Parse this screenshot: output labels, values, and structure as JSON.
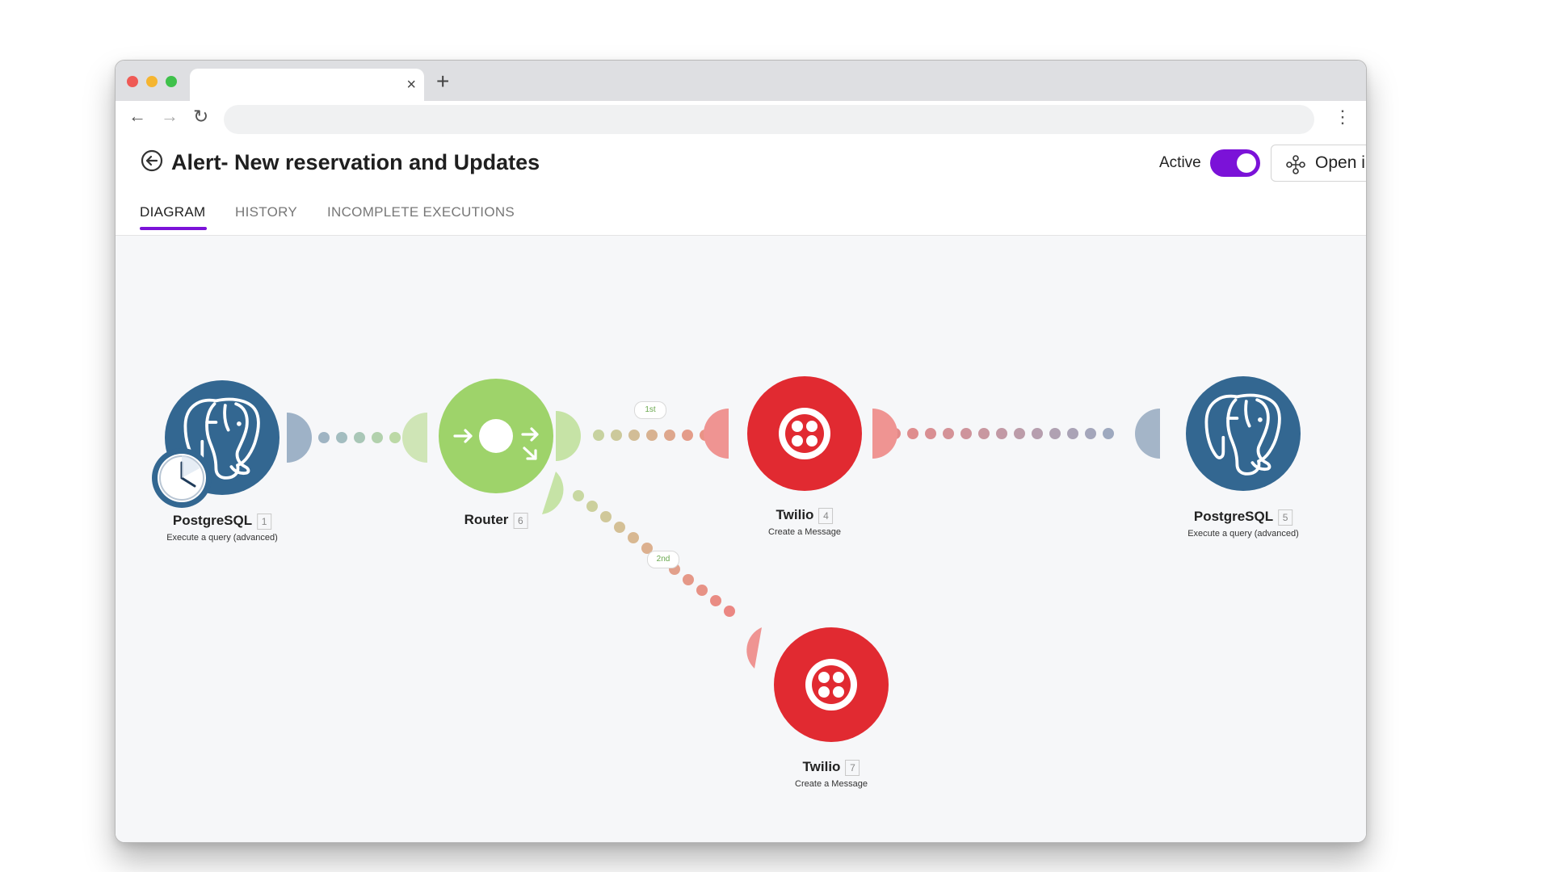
{
  "browser": {
    "tab_close": "×",
    "new_tab": "+",
    "back": "←",
    "forward": "→",
    "reload": "↻",
    "menu": "⋮"
  },
  "header": {
    "title": "Alert- New reservation and Updates",
    "active_label": "Active",
    "active_on": true,
    "open_button_label": "Open i"
  },
  "tabs": [
    {
      "label": "DIAGRAM",
      "selected": true
    },
    {
      "label": "HISTORY",
      "selected": false
    },
    {
      "label": "INCOMPLETE EXECUTIONS",
      "selected": false
    }
  ],
  "nodes": [
    {
      "name": "PostgreSQL",
      "number": "1",
      "subtitle": "Execute a query (advanced)",
      "icon": "postgresql-elephant-icon"
    },
    {
      "name": "Router",
      "number": "6",
      "subtitle": "",
      "icon": "router-icon"
    },
    {
      "name": "Twilio",
      "number": "4",
      "subtitle": "Create a Message",
      "icon": "twilio-icon"
    },
    {
      "name": "PostgreSQL",
      "number": "5",
      "subtitle": "Execute a query (advanced)",
      "icon": "postgresql-elephant-icon"
    },
    {
      "name": "Twilio",
      "number": "7",
      "subtitle": "Create a Message",
      "icon": "twilio-icon"
    }
  ],
  "routes": [
    {
      "label": "1st"
    },
    {
      "label": "2nd"
    }
  ],
  "colors": {
    "accent": "#7b12d8",
    "postgres": "#336791",
    "router": "#9ed36a",
    "twilio": "#e12a31",
    "canvas": "#f6f7f9"
  }
}
